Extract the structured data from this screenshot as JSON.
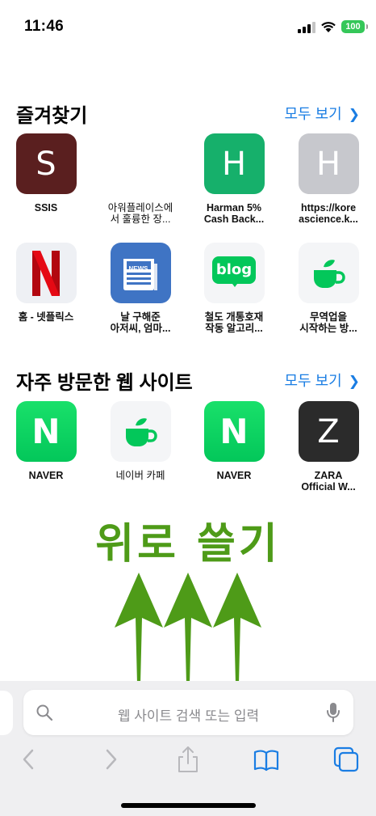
{
  "status": {
    "time": "11:46",
    "battery": "100"
  },
  "favorites": {
    "title": "즐겨찾기",
    "link": "모두 보기",
    "items": [
      {
        "label": "SSIS",
        "letter": "S",
        "icon": "letter-s-icon",
        "color": "#5a1f1f"
      },
      {
        "label": "아워플레이스에\n서 훌륭한 장...",
        "icon": "blank-icon"
      },
      {
        "label": "Harman 5%\nCash Back...",
        "letter": "H",
        "icon": "letter-h-icon",
        "color": "#16b06b"
      },
      {
        "label": "https://kore\nascience.k...",
        "letter": "H",
        "icon": "letter-h-icon",
        "color": "#c7c8cd"
      },
      {
        "label": "홈 - 넷플릭스",
        "icon": "netflix-icon",
        "color": "#e50914"
      },
      {
        "label": "날 구해준\n아저씨, 엄마...",
        "icon": "news-icon",
        "icon_text": "NEWS",
        "color": "#3f74c4"
      },
      {
        "label": "철도 개통호재\n작동 알고리...",
        "icon": "blog-icon",
        "icon_text": "blog",
        "color": "#03c75a"
      },
      {
        "label": "무역업을\n시작하는 방...",
        "icon": "cafe-cup-icon",
        "color": "#03c75a"
      }
    ]
  },
  "frequent": {
    "title": "자주 방문한 웹 사이트",
    "link": "모두 보기",
    "items": [
      {
        "label": "NAVER",
        "letter": "N",
        "icon": "naver-icon",
        "color": "#03c75a"
      },
      {
        "label": "네이버 카페",
        "icon": "cafe-cup-icon",
        "color": "#03c75a"
      },
      {
        "label": "NAVER",
        "letter": "N",
        "icon": "naver-icon",
        "color": "#03c75a"
      },
      {
        "label": "ZARA\nOfficial W...",
        "letter": "Z",
        "icon": "letter-z-icon",
        "color": "#2b2b2b"
      }
    ]
  },
  "overlay": {
    "caption": "위로 쓸기",
    "color": "#4e9b18"
  },
  "search": {
    "placeholder": "웹 사이트 검색 또는 입력"
  },
  "toolbar": {
    "accent": "#1a7de3",
    "disabled": "#b8b8bc"
  }
}
